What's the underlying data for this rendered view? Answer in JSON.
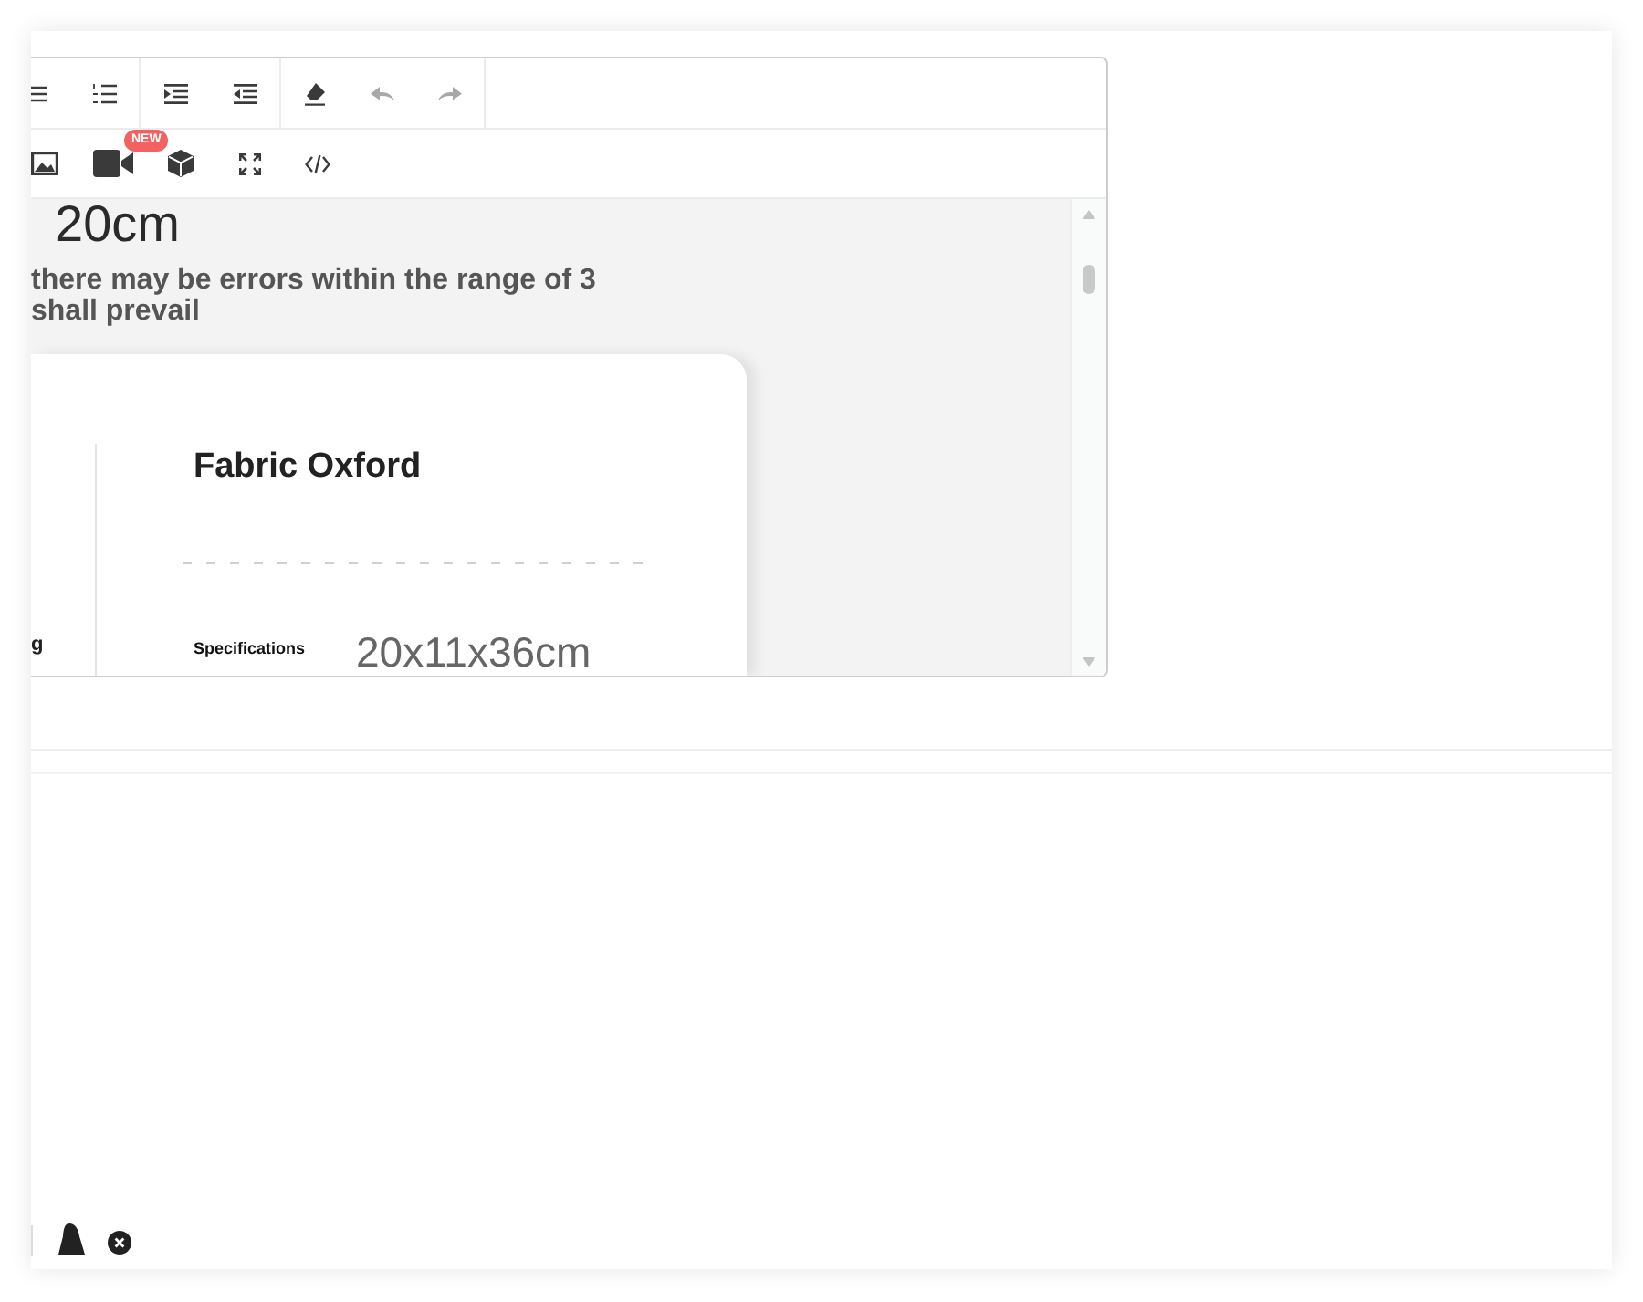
{
  "editor": {
    "toolbar_rows": [
      {
        "groups": [
          {
            "tools": [
              {
                "kind": "bullet_list",
                "disabled": false
              },
              {
                "kind": "numbered_list",
                "disabled": false
              }
            ]
          },
          {
            "tools": [
              {
                "kind": "indent",
                "disabled": false
              },
              {
                "kind": "outdent",
                "disabled": false
              }
            ]
          },
          {
            "tools": [
              {
                "kind": "clear_format",
                "disabled": false
              },
              {
                "kind": "undo",
                "disabled": true
              },
              {
                "kind": "redo",
                "disabled": true
              }
            ]
          }
        ]
      },
      {
        "groups": [
          {
            "tools": [
              {
                "kind": "image",
                "disabled": false
              },
              {
                "kind": "video",
                "disabled": false,
                "badge": "NEW"
              },
              {
                "kind": "model_3d",
                "disabled": false
              },
              {
                "kind": "fullscreen",
                "disabled": false
              },
              {
                "kind": "source_code",
                "disabled": false
              }
            ]
          }
        ]
      }
    ],
    "document": {
      "size_text": "20cm",
      "note_lines": [
        "there may be errors within the range of 3",
        "shall prevail"
      ],
      "spec_card": {
        "side_label": "g",
        "title": "Fabric Oxford",
        "specs": [
          {
            "label": "Specifications",
            "value": "20x11x36cm"
          }
        ]
      }
    }
  }
}
